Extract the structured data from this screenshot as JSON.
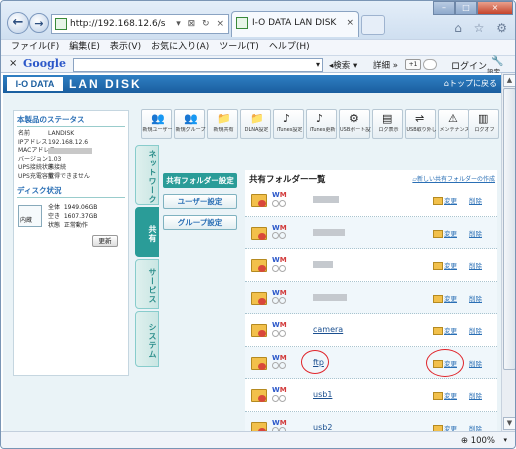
{
  "browser": {
    "url": "http://192.168.12.6/s",
    "tab_title": "I-O DATA LAN DISK",
    "tab_close": "×",
    "window_controls": {
      "minimize": "–",
      "maximize": "□",
      "close": "×"
    },
    "nav_icons": [
      "back-icon",
      "forward-icon"
    ],
    "top_icons": "⌂ ☆ ⚙",
    "menu": [
      "ファイル(F)",
      "編集(E)",
      "表示(V)",
      "お気に入り(A)",
      "ツール(T)",
      "ヘルプ(H)"
    ],
    "toolbar": {
      "close": "×",
      "google_logo": "Google",
      "search_label": "検索",
      "detail_label": "詳細 »",
      "plus_label": "+1",
      "login_label": "ログイン",
      "settings_label": "設定"
    },
    "zoom": "100%"
  },
  "header": {
    "brand": "I-O DATA",
    "product": "LAN DISK",
    "top_link": "トップに戻る"
  },
  "status_panel": {
    "title": "本製品のステータス",
    "fields": [
      {
        "key": "名前",
        "value": "LANDISK"
      },
      {
        "key": "IPアドレス",
        "value": "192.168.12.6"
      },
      {
        "key": "MACアドレス",
        "value": ""
      },
      {
        "key": "バージョン",
        "value": "1.03"
      },
      {
        "key": "UPS接続状態",
        "value": "未接続"
      },
      {
        "key": "UPS充電容量",
        "value": "取得できません"
      }
    ],
    "disk_title": "ディスク状況",
    "disk_label": "内蔵",
    "disk_fields": [
      {
        "key": "全体",
        "value": "1949.06GB"
      },
      {
        "key": "空き",
        "value": "1607.37GB"
      },
      {
        "key": "状態",
        "value": "正常動作"
      }
    ],
    "update_button": "更新"
  },
  "tools": [
    {
      "label": "新規ユーザー",
      "icon": "new-user-icon",
      "glyph": "👥"
    },
    {
      "label": "新規グループ",
      "icon": "new-group-icon",
      "glyph": "👥"
    },
    {
      "label": "新規共有",
      "icon": "new-share-icon",
      "glyph": "📁"
    },
    {
      "label": "DLNA設定",
      "icon": "dlna-icon",
      "glyph": "📁"
    },
    {
      "label": "iTunes設定",
      "icon": "itunes-icon",
      "glyph": "♪"
    },
    {
      "label": "iTunes更新",
      "icon": "itunes-update-icon",
      "glyph": "♪"
    },
    {
      "label": "USBポート設定",
      "icon": "usb-port-icon",
      "glyph": "⚙"
    },
    {
      "label": "ログ表示",
      "icon": "log-icon",
      "glyph": "▤"
    },
    {
      "label": "USB取り外し",
      "icon": "usb-remove-icon",
      "glyph": "⇌"
    },
    {
      "label": "メンテナンス",
      "icon": "maintenance-icon",
      "glyph": "⚠"
    },
    {
      "label": "ログオフ",
      "icon": "logoff-icon",
      "glyph": "▥"
    }
  ],
  "side_tabs": [
    {
      "label": "ネットワーク",
      "active": false
    },
    {
      "label": "共有",
      "active": true
    },
    {
      "label": "サービス",
      "active": false
    },
    {
      "label": "システム",
      "active": false
    }
  ],
  "submenu": [
    {
      "label": "共有フォルダー設定",
      "active": true
    },
    {
      "label": "ユーザー設定",
      "active": false
    },
    {
      "label": "グループ設定",
      "active": false
    }
  ],
  "main": {
    "title": "共有フォルダー一覧",
    "new_link": "新しい共有フォルダーの作成",
    "change_label": "変更",
    "delete_label": "削除",
    "perm_w": "W",
    "perm_m": "M",
    "rows": [
      {
        "name": ""
      },
      {
        "name": ""
      },
      {
        "name": ""
      },
      {
        "name": ""
      },
      {
        "name": "camera"
      },
      {
        "name": "ftp"
      },
      {
        "name": "usb1"
      },
      {
        "name": "usb2"
      }
    ]
  }
}
